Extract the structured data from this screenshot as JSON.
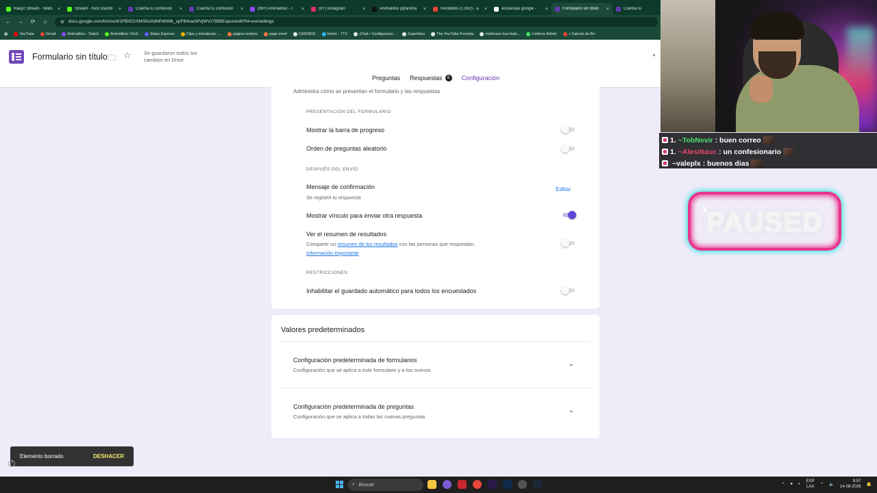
{
  "browser": {
    "tabs": [
      {
        "title": "Rakyz Stream - Wats",
        "color": "#53fc18",
        "active": false
      },
      {
        "title": "Stream - Kick Dashb",
        "color": "#53fc18",
        "active": false
      },
      {
        "title": "Cuenta tu confesión",
        "color": "#673ab7",
        "active": false
      },
      {
        "title": "Cuenta tu confesión",
        "color": "#673ab7",
        "active": false
      },
      {
        "title": "(99+) Animalitoo - T",
        "color": "#9146ff",
        "active": false
      },
      {
        "title": "(9+) Instagram",
        "color": "#e1306c",
        "active": false
      },
      {
        "title": "Animalitoo (@anima",
        "color": "#111111",
        "active": false
      },
      {
        "title": "Recibidos (1,092) - a",
        "color": "#ea4335",
        "active": false
      },
      {
        "title": "encuestas google - ",
        "color": "#ffffff",
        "active": false
      },
      {
        "title": "Formulario sin título",
        "color": "#673ab7",
        "active": true
      },
      {
        "title": "Cuenta tu",
        "color": "#673ab7",
        "active": false
      }
    ],
    "url": "docs.google.com/forms/d/1PBrEGXMS5oXdNPd0Wk_spFB4racWVjWVzTBlBEspsn/edit?hl=es#settings",
    "bookmarks": [
      {
        "label": "YouTube",
        "color": "#ff0000"
      },
      {
        "label": "Gmail",
        "color": "#ea4335"
      },
      {
        "label": "Animalitoo - Twitch",
        "color": "#9146ff"
      },
      {
        "label": "Animalitoo | Kick",
        "color": "#53fc18"
      },
      {
        "label": "Stripe Express",
        "color": "#635bff"
      },
      {
        "label": "Clips y miniaturas -...",
        "color": "#f4b400"
      },
      {
        "label": "página sorteos",
        "color": "#ff7043"
      },
      {
        "label": "pago emel",
        "color": "#ff7043"
      },
      {
        "label": "CASINOS",
        "color": "#e2ece7"
      },
      {
        "label": "Home - 7TV",
        "color": "#29b6f6"
      },
      {
        "label": "¡Chat • Configuració...",
        "color": "#e2ece7"
      },
      {
        "label": "Superfans",
        "color": "#e2ece7"
      },
      {
        "label": "The YouTube Formula",
        "color": "#e2ece7"
      },
      {
        "label": "mohicano-low-fade...",
        "color": "#e2ece7"
      },
      {
        "label": "Linktree Admin",
        "color": "#43e660"
      },
      {
        "label": "» Calculo de Bo",
        "color": "#ea4335"
      }
    ]
  },
  "header": {
    "title": "Formulario sin título",
    "saved_status": "Se guardaron todos los cambios en Drive",
    "tabs": [
      {
        "label": "Preguntas",
        "badge": "",
        "active": false
      },
      {
        "label": "Respuestas",
        "badge": "6",
        "active": false
      },
      {
        "label": "Configuración",
        "badge": "",
        "active": true
      }
    ]
  },
  "presentation_card": {
    "description": "Administra cómo se presentan el formulario y las respuestas",
    "section_form": "PRESENTACIÓN DEL FORMULARIO",
    "progress_bar": {
      "label": "Mostrar la barra de progreso",
      "on": false
    },
    "shuffle": {
      "label": "Orden de preguntas aleatorio",
      "on": false
    },
    "section_after": "DESPUÉS DEL ENVÍO",
    "confirmation": {
      "label": "Mensaje de confirmación",
      "value": "Se registró tu respuesta",
      "edit": "Editar"
    },
    "another_response": {
      "label": "Mostrar vínculo para enviar otra respuesta",
      "on": true
    },
    "summary": {
      "label": "Ver el resumen de resultados",
      "desc_pre": "Comparte un ",
      "desc_link": "resumen de los resultados",
      "desc_post": " con las personas que respondan.",
      "info_link": "Información importante",
      "on": false
    },
    "section_restrictions": "RESTRICCIONES:",
    "autosave": {
      "label": "Inhabilitar el guardado automático para todos los encuestados",
      "on": false
    }
  },
  "defaults_card": {
    "title": "Valores predeterminados",
    "items": [
      {
        "title": "Configuración predeterminada de formularios",
        "subtitle": "Configuración que se aplica a este formulario y a los nuevos"
      },
      {
        "title": "Configuración predeterminada de preguntas",
        "subtitle": "Configuración que se aplica a todas las nuevas preguntas"
      }
    ]
  },
  "snackbar": {
    "message": "Elemento borrado",
    "action": "DESHACER"
  },
  "stream": {
    "chat": [
      {
        "rank": "1.",
        "user": "~TobNevir",
        "message": ": buen correo",
        "user_color": "#4de06e"
      },
      {
        "rank": "1.",
        "user": "~Alesittauc",
        "message": ": un confesionario",
        "user_color": "#e8466d"
      },
      {
        "rank": "",
        "user": "~valeplx",
        "message": ": buenos dias",
        "user_color": "#ffffff"
      }
    ],
    "overlay": "PAUSED"
  },
  "taskbar": {
    "search_placeholder": "Buscar",
    "lang_top": "ESP",
    "lang_bottom": "LAA",
    "time": "8:57",
    "date": "14-08-2026"
  }
}
